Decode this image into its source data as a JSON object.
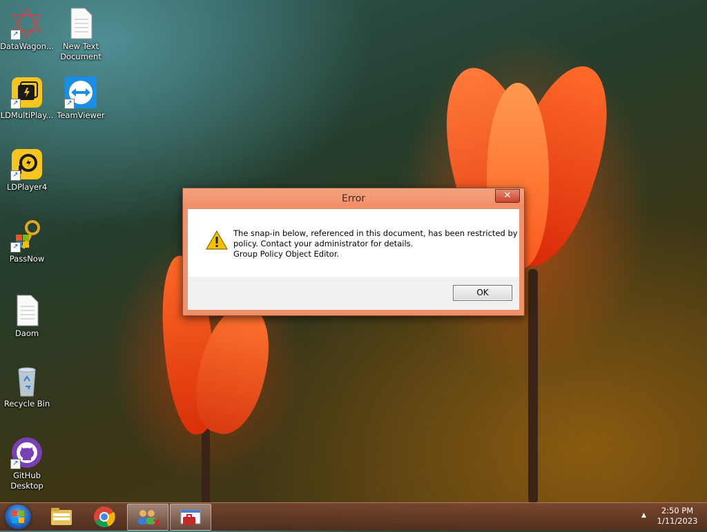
{
  "desktop": {
    "icons": [
      {
        "label": "DataWagon..."
      },
      {
        "label": "New Text Document"
      },
      {
        "label": "LDMultiPlay..."
      },
      {
        "label": "TeamViewer"
      },
      {
        "label": "LDPlayer4"
      },
      {
        "label": "PassNow"
      },
      {
        "label": "Daom"
      },
      {
        "label": "Recycle Bin"
      },
      {
        "label": "GitHub Desktop"
      }
    ]
  },
  "dialog": {
    "title": "Error",
    "close_glyph": "✕",
    "message_lines": [
      "The snap-in below, referenced in this document, has been restricted by",
      "policy. Contact your administrator for details.",
      "Group Policy Object Editor."
    ],
    "ok_label": "OK"
  },
  "taskbar": {
    "tray_arrow": "▲",
    "time": "2:50 PM",
    "date": "1/11/2023"
  },
  "colors": {
    "dialog_frame": "#f0906a",
    "taskbar": "#6b3d2a",
    "warning": "#f2c200"
  }
}
